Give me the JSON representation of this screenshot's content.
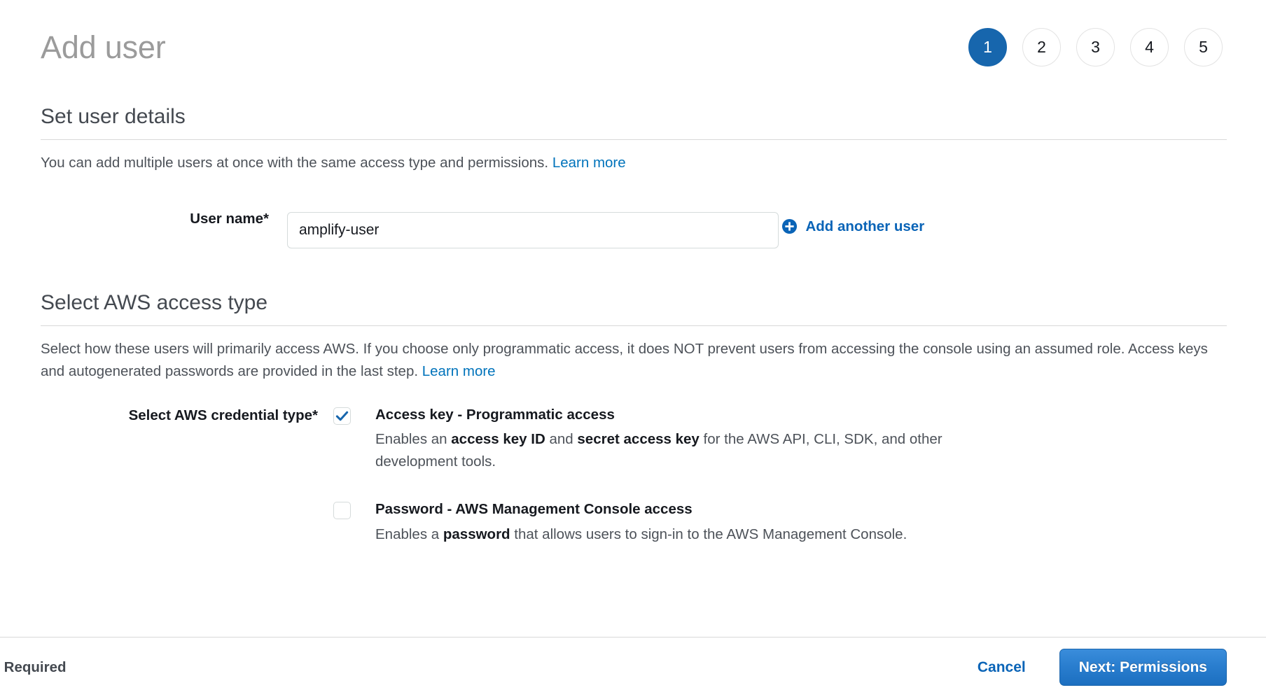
{
  "header": {
    "title": "Add user",
    "steps": [
      {
        "label": "1",
        "active": true
      },
      {
        "label": "2",
        "active": false
      },
      {
        "label": "3",
        "active": false
      },
      {
        "label": "4",
        "active": false
      },
      {
        "label": "5",
        "active": false
      }
    ]
  },
  "user_details": {
    "section_title": "Set user details",
    "description_text": "You can add multiple users at once with the same access type and permissions.",
    "learn_more": "Learn more",
    "user_name_label": "User name*",
    "user_name_value": "amplify-user",
    "user_name_placeholder": "",
    "add_another_user": "Add another user"
  },
  "access_type": {
    "section_title": "Select AWS access type",
    "description_text": "Select how these users will primarily access AWS. If you choose only programmatic access, it does NOT prevent users from accessing the console using an assumed role. Access keys and autogenerated passwords are provided in the last step.",
    "learn_more": "Learn more",
    "credential_type_label": "Select AWS credential type*",
    "options": [
      {
        "checked": true,
        "title": "Access key - Programmatic access",
        "desc_part1": "Enables an ",
        "desc_bold1": "access key ID",
        "desc_part2": " and ",
        "desc_bold2": "secret access key",
        "desc_part3": " for the AWS API, CLI, SDK, and other development tools."
      },
      {
        "checked": false,
        "title": "Password - AWS Management Console access",
        "desc_part1": "Enables a ",
        "desc_bold1": "password",
        "desc_part2": " that allows users to sign-in to the AWS Management Console.",
        "desc_bold2": "",
        "desc_part3": ""
      }
    ]
  },
  "footer": {
    "required_note": "* Required",
    "cancel_label": "Cancel",
    "next_label": "Next: Permissions"
  },
  "colors": {
    "accent_blue": "#0073bb",
    "link_blue": "#0a64b7",
    "active_step": "#1766ad",
    "button_blue": "#2a7ecf",
    "title_gray": "#9b9b9b",
    "border_gray": "#d8d8d8"
  }
}
